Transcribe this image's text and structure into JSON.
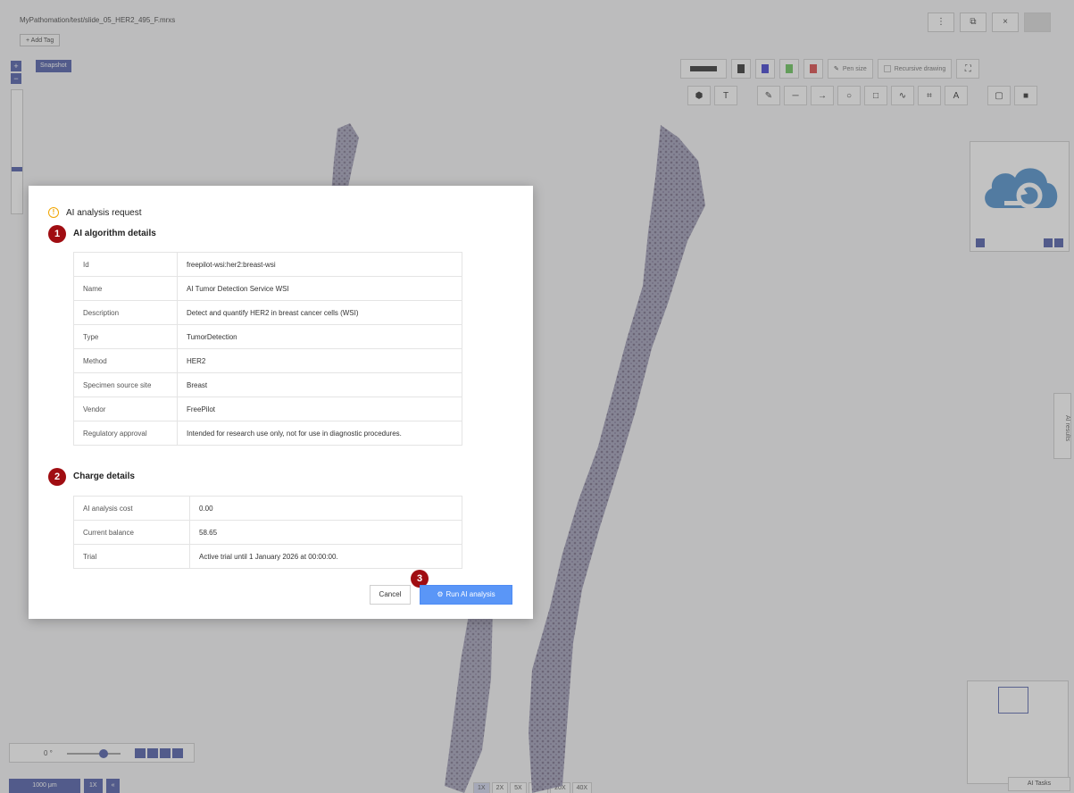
{
  "window": {
    "path_title": "MyPathomation/test/slide_05_HER2_495_F.mrxs",
    "add_tag_label": "+ Add Tag",
    "controls": [
      "⋮",
      "⧉",
      "×",
      ""
    ]
  },
  "viewer": {
    "snapshot_label": "Snapshot",
    "zoom_in_symbol": "+",
    "zoom_out_symbol": "−",
    "pen_size_label": "Pen size",
    "recursive_drawing_label": "Recursive drawing",
    "ai_results_tab_label": "AI results",
    "ai_tasks_label": "AI Tasks",
    "rotation_label": "0 °",
    "scale_label": "1000 μm",
    "scale_zoom_label": "1X",
    "magnifications": [
      "1X",
      "2X",
      "5X",
      "10X",
      "20X",
      "40X"
    ],
    "pen_colors": [
      "#222222",
      "#2f2fcc",
      "#5cbf4c",
      "#d83a3a"
    ],
    "draw_tool_icons": [
      "⬢",
      "T",
      "✎",
      "─",
      "→",
      "○",
      "□",
      "∿",
      "⌗",
      "A",
      "▢",
      "■"
    ]
  },
  "modal": {
    "header_title": "AI analysis request",
    "algorithm_section": {
      "step": "1",
      "title": "AI algorithm details",
      "rows": [
        {
          "key": "Id",
          "value": "freepilot-wsi:her2:breast-wsi"
        },
        {
          "key": "Name",
          "value": "AI Tumor Detection Service WSI"
        },
        {
          "key": "Description",
          "value": "Detect and quantify HER2 in breast cancer cells (WSI)"
        },
        {
          "key": "Type",
          "value": "TumorDetection"
        },
        {
          "key": "Method",
          "value": "HER2"
        },
        {
          "key": "Specimen source site",
          "value": "Breast"
        },
        {
          "key": "Vendor",
          "value": "FreePilot"
        },
        {
          "key": "Regulatory approval",
          "value": "Intended for research use only, not for use in diagnostic procedures."
        }
      ]
    },
    "charge_section": {
      "step": "2",
      "title": "Charge details",
      "rows": [
        {
          "key": "AI analysis cost",
          "value": "0.00"
        },
        {
          "key": "Current balance",
          "value": "58.65"
        },
        {
          "key": "Trial",
          "value": "Active trial until 1 January 2026 at 00:00:00."
        }
      ]
    },
    "actions_step": "3",
    "cancel_label": "Cancel",
    "run_label": "Run AI analysis"
  },
  "colors": {
    "accent": "#3f4fa0",
    "step_badge": "#a00d12",
    "primary_button": "#5a96f7",
    "warning_icon": "#f0a500"
  }
}
